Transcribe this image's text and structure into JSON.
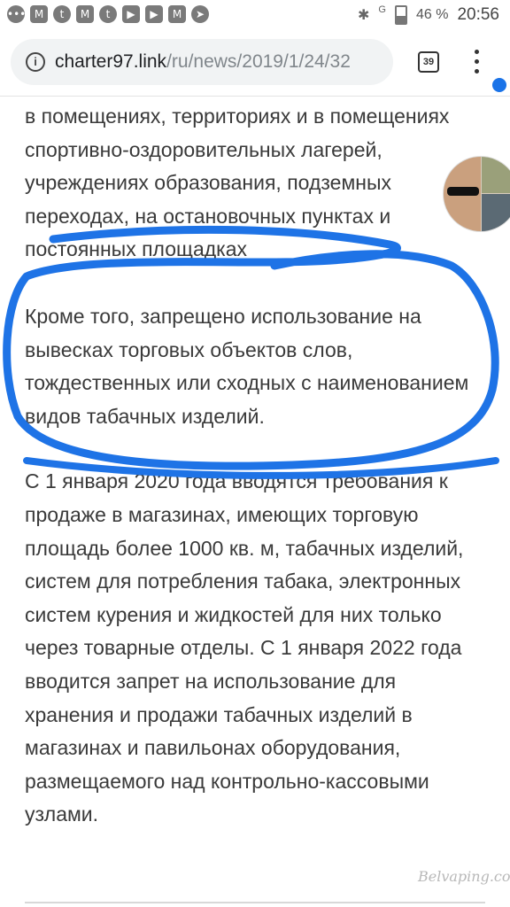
{
  "status_bar": {
    "battery_pct": "46 %",
    "time": "20:56",
    "signal_label": "G",
    "notification_icons": [
      "gmail-icon",
      "tumblr-icon",
      "youtube-icon",
      "telegram-icon"
    ]
  },
  "browser": {
    "url_host": "charter97.link",
    "url_path": "/ru/news/2019/1/24/32",
    "tab_count": "39"
  },
  "article": {
    "paragraph1": "в помещениях, территориях и в помещениях спортивно-оздоровительных лагерей, учреждениях образования, подземных переходах, на остановочных пунктах и постоянных площадках",
    "paragraph2": "Кроме того, запрещено использование на вывесках торговых объектов слов, тождественных или сходных с наименованием видов табачных изделий.",
    "paragraph3": "С 1 января 2020 года вводятся требования к продаже в магазинах, имеющих торговую площадь более 1000 кв. м, табачных изделий, систем для потребления табака, электронных систем курения и жидкостей для них только через товарные отделы. С 1 января 2022 года вводится запрет на использование для хранения и продажи табачных изделий в магазинах и павильонах оборудования, размещаемого над контрольно-кассовыми узлами."
  },
  "annotation": {
    "color": "#1e73e6"
  },
  "watermark": "Belvaping.com"
}
